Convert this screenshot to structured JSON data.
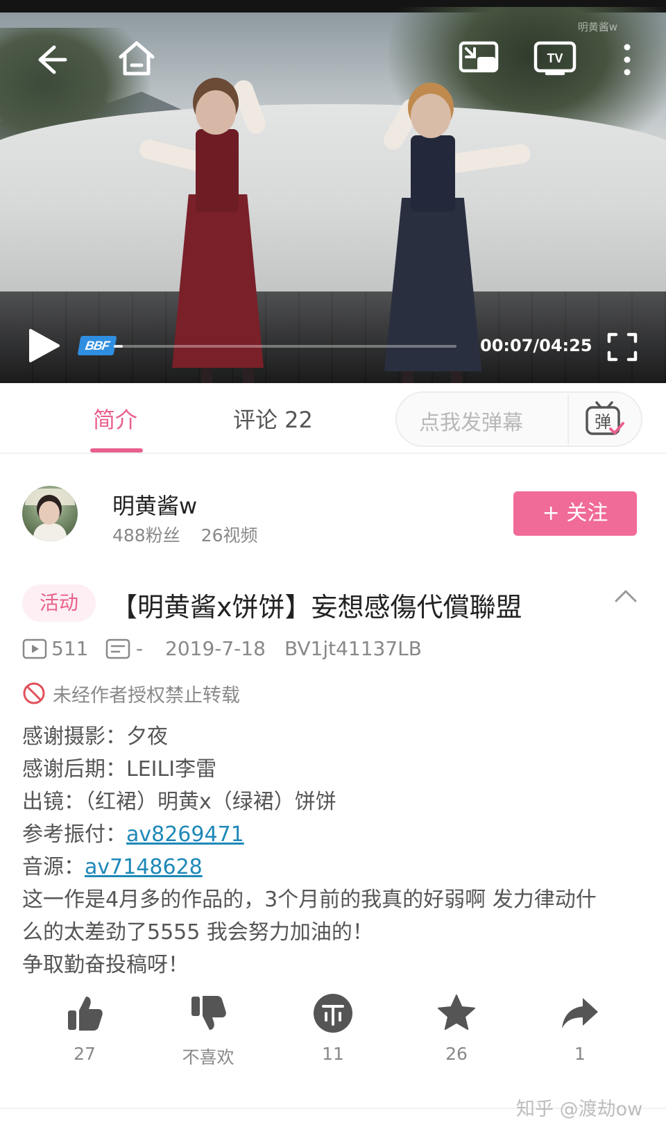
{
  "player": {
    "watermark": "明黄酱w",
    "time": "00:07/04:25",
    "progress_fraction": 0.027,
    "logo_text": "BBF",
    "icons": {
      "back": "back-arrow-icon",
      "home": "home-icon",
      "pip": "picture-in-picture-icon",
      "cast": "tv-cast-icon",
      "more": "more-vertical-icon",
      "play": "play-icon",
      "fullscreen": "fullscreen-icon"
    }
  },
  "tabs": {
    "intro": "简介",
    "comments": "评论 22",
    "danmaku_placeholder": "点我发弹幕",
    "danmaku_icon_char": "弹"
  },
  "uploader": {
    "name": "明黄酱w",
    "fans": "488粉丝",
    "videos": "26视频",
    "follow": "+ 关注"
  },
  "video": {
    "tag": "活动",
    "title": "【明黄酱x饼饼】妄想感傷代償聯盟",
    "plays": "511",
    "danmaku": "-",
    "date": "2019-7-18",
    "bvid": "BV1jt41137LB",
    "copyright": "未经作者授权禁止转载"
  },
  "description": {
    "photo": "感谢摄影：夕夜",
    "post": "感谢后期：LEILI李雷",
    "cast": "出镜：（红裙）明黄x（绿裙）饼饼",
    "ref_label": "参考振付：",
    "ref_link": "av8269471",
    "music_label": "音源：",
    "music_link": "av7148628",
    "text1": "这一作是4月多的作品的，3个月前的我真的好弱啊 发力律动什",
    "text2": "么的太差劲了5555 我会努力加油的！",
    "text3": "争取勤奋投稿呀！"
  },
  "actions": {
    "like": "27",
    "dislike": "不喜欢",
    "coin": "11",
    "favorite": "26",
    "share": "1"
  },
  "footer": {
    "watermark": "知乎 @渡劫ow"
  },
  "colors": {
    "accent": "#e9608c",
    "follow_bg": "#f06b97",
    "link": "#1e88b8"
  }
}
